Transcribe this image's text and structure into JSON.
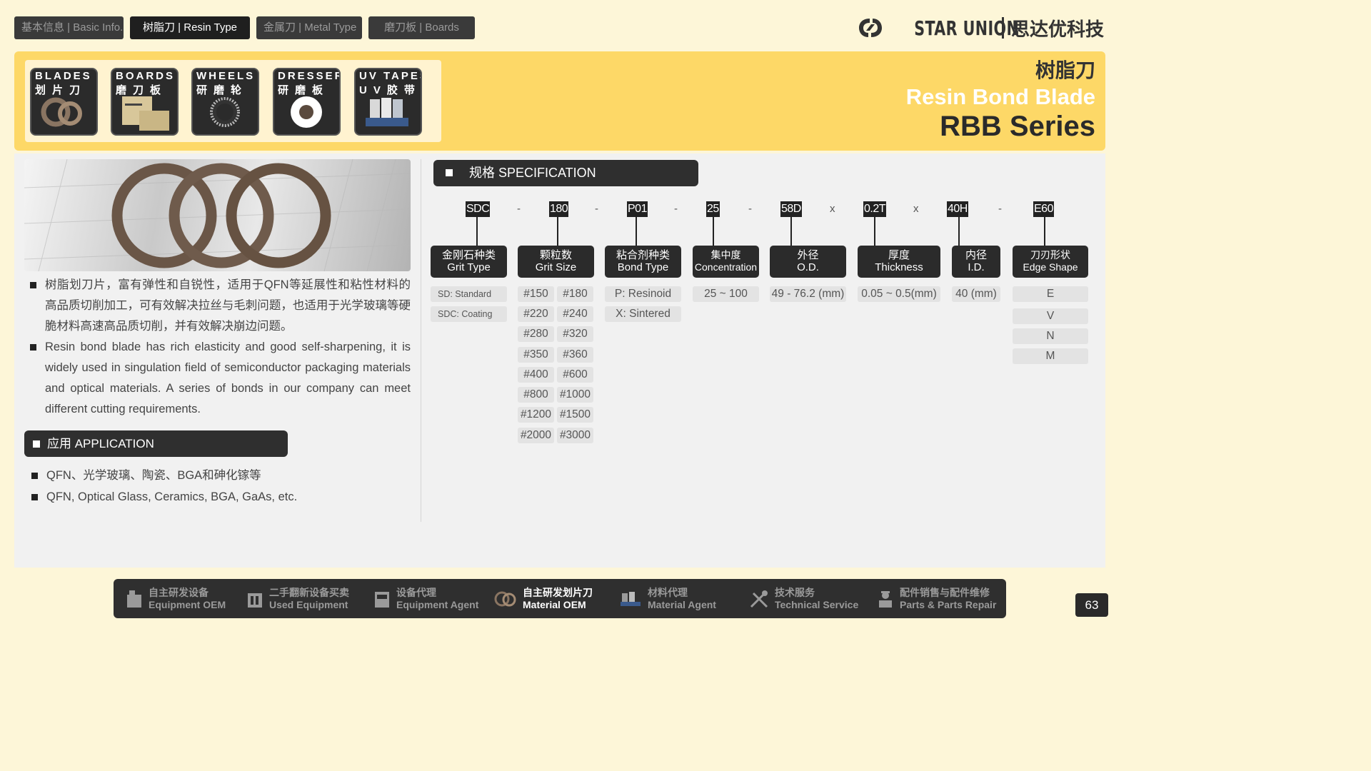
{
  "nav": {
    "tabs": [
      {
        "label": "基本信息 | Basic Info."
      },
      {
        "label": "树脂刀 | Resin Type"
      },
      {
        "label": "金属刀 | Metal Type"
      },
      {
        "label": "磨刀板 | Boards"
      }
    ]
  },
  "brand": {
    "en": "STAR UNION",
    "cn": "思达优科技"
  },
  "products": [
    {
      "en": "BLADES",
      "cn": "划片刀"
    },
    {
      "en": "BOARDS",
      "cn": "磨刀板"
    },
    {
      "en": "WHEELS",
      "cn": "研磨轮"
    },
    {
      "en": "DRESSER",
      "cn": "研磨板"
    },
    {
      "en": "UV TAPES",
      "cn": "UV胶带"
    }
  ],
  "title": {
    "cn": "树脂刀",
    "en1": "Resin Bond Blade",
    "en2": "RBB Series"
  },
  "description": [
    "树脂划刀片，富有弹性和自锐性，适用于QFN等延展性和粘性材料的高品质切削加工，可有效解决拉丝与毛刺问题，也适用于光学玻璃等硬脆材料高速高品质切削，并有效解决崩边问题。",
    "Resin bond blade has rich elasticity and good self-sharpening, it is widely used in singulation field of semiconductor packaging materials and optical materials. A series of bonds in our company can meet different cutting requirements."
  ],
  "application": {
    "heading": "应用 APPLICATION",
    "items": [
      "QFN、光学玻璃、陶瓷、BGA和砷化镓等",
      "QFN, Optical Glass, Ceramics, BGA, GaAs, etc."
    ]
  },
  "spec": {
    "heading": "规格 SPECIFICATION",
    "codes": [
      "SDC",
      "180",
      "P01",
      "25",
      "58D",
      "0.2T",
      "40H",
      "E60"
    ],
    "separators": [
      "-",
      "-",
      "-",
      "-",
      "x",
      "x",
      "-"
    ],
    "labels": [
      {
        "cn": "金刚石种类",
        "en": "Grit Type"
      },
      {
        "cn": "颗粒数",
        "en": "Grit Size"
      },
      {
        "cn": "粘合剂种类",
        "en": "Bond Type"
      },
      {
        "cn": "集中度",
        "en": "Concentration"
      },
      {
        "cn": "外径",
        "en": "O.D."
      },
      {
        "cn": "厚度",
        "en": "Thickness"
      },
      {
        "cn": "内径",
        "en": "I.D."
      },
      {
        "cn": "刀刃形状",
        "en": "Edge Shape"
      }
    ],
    "grit_type": [
      "SD: Standard",
      "SDC: Coating"
    ],
    "grit_size": [
      "#150",
      "#180",
      "#220",
      "#240",
      "#280",
      "#320",
      "#350",
      "#360",
      "#400",
      "#600",
      "#800",
      "#1000",
      "#1200",
      "#1500",
      "#2000",
      "#3000"
    ],
    "bond_type": [
      "P: Resinoid",
      "X: Sintered"
    ],
    "concentration": "25 ~ 100",
    "od": "49 - 76.2 (mm)",
    "thickness": "0.05 ~ 0.5(mm)",
    "id": "40 (mm)",
    "edge_shape": [
      "E",
      "V",
      "N",
      "M"
    ]
  },
  "bottom": [
    {
      "cn": "自主研发设备",
      "en": "Equipment OEM"
    },
    {
      "cn": "二手翻新设备买卖",
      "en": "Used Equipment"
    },
    {
      "cn": "设备代理",
      "en": "Equipment Agent"
    },
    {
      "cn": "自主研发划片刀",
      "en": "Material OEM"
    },
    {
      "cn": "材料代理",
      "en": "Material Agent"
    },
    {
      "cn": "技术服务",
      "en": "Technical Service"
    },
    {
      "cn": "配件销售与配件维修",
      "en": "Parts & Parts Repair"
    }
  ],
  "page_number": "63",
  "colors": {
    "banner": "#fdd867",
    "background": "#fdf6d8",
    "dark": "#2f2f2f"
  }
}
